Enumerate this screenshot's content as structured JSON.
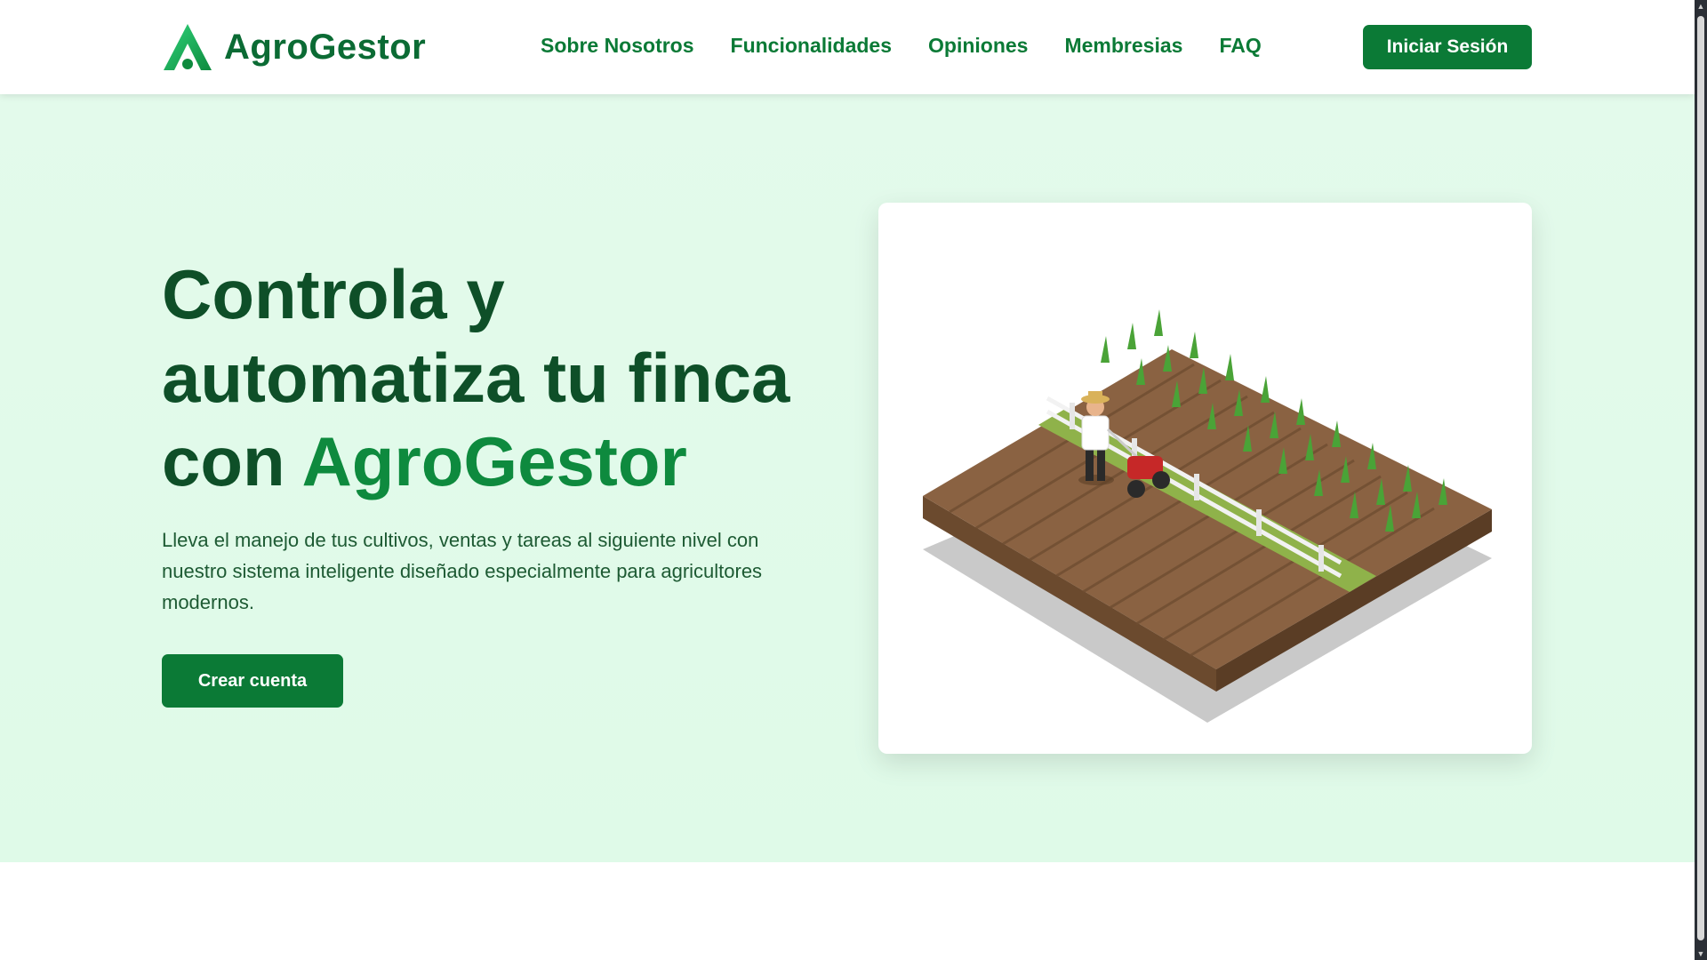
{
  "brand": {
    "name": "AgroGestor",
    "color": "#0b7a36"
  },
  "nav": {
    "items": [
      {
        "label": "Sobre Nosotros"
      },
      {
        "label": "Funcionalidades"
      },
      {
        "label": "Opiniones"
      },
      {
        "label": "Membresias"
      },
      {
        "label": "FAQ"
      }
    ],
    "login_label": "Iniciar Sesión"
  },
  "hero": {
    "headline_part1": "Controla y automatiza tu finca con ",
    "headline_accent": "AgroGestor",
    "subtext": "Lleva el manejo de tus cultivos, ventas y tareas al siguiente nivel con nuestro sistema inteligente diseñado especialmente para agricultores modernos.",
    "cta_label": "Crear cuenta",
    "background_color": "#e3faeb"
  }
}
